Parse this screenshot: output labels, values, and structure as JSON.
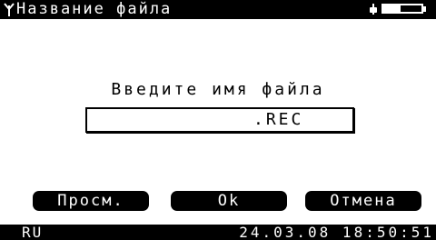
{
  "title": {
    "text": "Название файла",
    "icon": "antenna-icon"
  },
  "status_icons": {
    "power": "plug-icon",
    "battery_level": 0.45
  },
  "dialog": {
    "prompt": "Введите имя файла",
    "filename_value": "",
    "extension": ".REC"
  },
  "softkeys": {
    "view": "Просм.",
    "ok": "Ok",
    "cancel": "Отмена"
  },
  "status_bar": {
    "language": "RU",
    "datetime": "24.03.08 18:50:51"
  },
  "colors": {
    "foreground": "#000000",
    "background": "#ffffff"
  }
}
